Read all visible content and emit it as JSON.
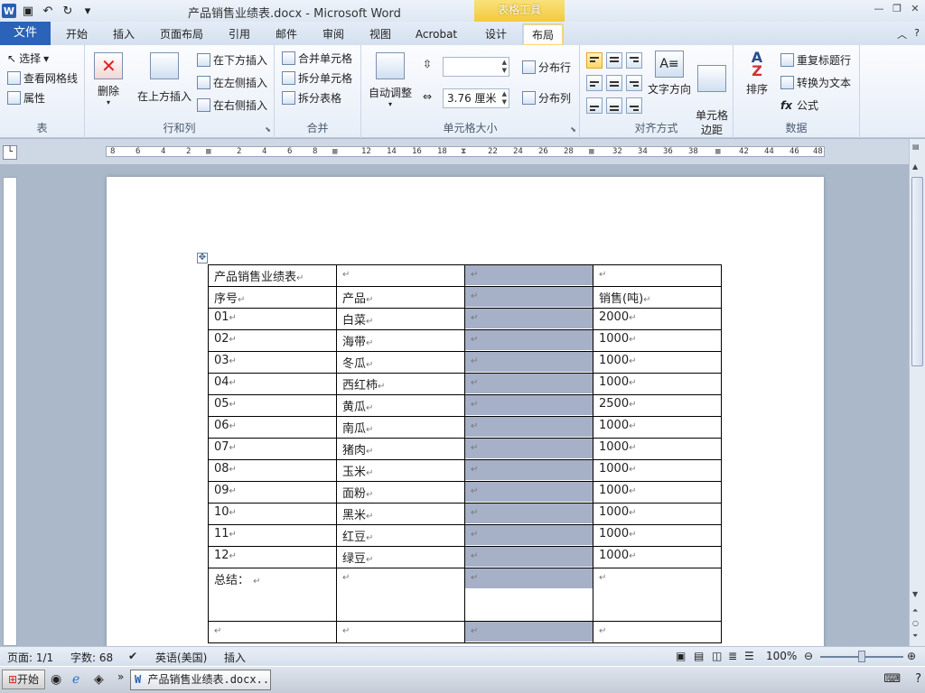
{
  "window": {
    "title": "产品销售业绩表.docx  -  Microsoft Word",
    "context_tab": "表格工具"
  },
  "tabs": [
    "文件",
    "开始",
    "插入",
    "页面布局",
    "引用",
    "邮件",
    "审阅",
    "视图",
    "Acrobat",
    "设计",
    "布局"
  ],
  "ribbon": {
    "table": {
      "label": "表",
      "select": "选择",
      "gridlines": "查看网格线",
      "properties": "属性"
    },
    "rows_cols": {
      "label": "行和列",
      "delete": "删除",
      "insert_above": "在上方插入",
      "insert_below": "在下方插入",
      "insert_left": "在左侧插入",
      "insert_right": "在右侧插入"
    },
    "merge": {
      "label": "合并",
      "merge_cells": "合并单元格",
      "split_cells": "拆分单元格",
      "split_table": "拆分表格"
    },
    "cell_size": {
      "label": "单元格大小",
      "autofit": "自动调整",
      "height_value": "",
      "width_value": "3.76 厘米",
      "distribute_rows": "分布行",
      "distribute_cols": "分布列"
    },
    "alignment": {
      "label": "对齐方式",
      "text_direction": "文字方向",
      "cell_margins": "单元格\n边距"
    },
    "data": {
      "label": "数据",
      "sort": "排序",
      "repeat_header": "重复标题行",
      "convert_text": "转换为文本",
      "formula": "公式"
    }
  },
  "ruler_numbers": [
    "8",
    "6",
    "4",
    "2",
    "",
    "2",
    "4",
    "6",
    "8",
    "",
    "12",
    "14",
    "16",
    "18",
    "",
    "22",
    "24",
    "26",
    "28",
    "",
    "32",
    "34",
    "36",
    "38",
    "",
    "42",
    "44",
    "46",
    "48"
  ],
  "document": {
    "title_cell": "产品销售业绩表",
    "headers": [
      "序号",
      "产品",
      "",
      "销售(吨)"
    ],
    "rows": [
      [
        "01",
        "白菜",
        "",
        "2000"
      ],
      [
        "02",
        "海带",
        "",
        "1000"
      ],
      [
        "03",
        "冬瓜",
        "",
        "1000"
      ],
      [
        "04",
        "西红柿",
        "",
        "1000"
      ],
      [
        "05",
        "黄瓜",
        "",
        "2500"
      ],
      [
        "06",
        "南瓜",
        "",
        "1000"
      ],
      [
        "07",
        "猪肉",
        "",
        "1000"
      ],
      [
        "08",
        "玉米",
        "",
        "1000"
      ],
      [
        "09",
        "面粉",
        "",
        "1000"
      ],
      [
        "10",
        "黑米",
        "",
        "1000"
      ],
      [
        "11",
        "红豆",
        "",
        "1000"
      ],
      [
        "12",
        "绿豆",
        "",
        "1000"
      ]
    ],
    "summary_label": "总结：",
    "paragraph_mark": "↵"
  },
  "status": {
    "page": "页面: 1/1",
    "words": "字数: 68",
    "language": "英语(美国)",
    "mode": "插入",
    "zoom": "100%"
  },
  "taskbar": {
    "start": "开始",
    "window": "产品销售业绩表.docx..."
  },
  "colors": {
    "file_tab": "#2a63b8",
    "cell_shade": "#a6b0c6",
    "context_tab": "#f4c93d"
  }
}
